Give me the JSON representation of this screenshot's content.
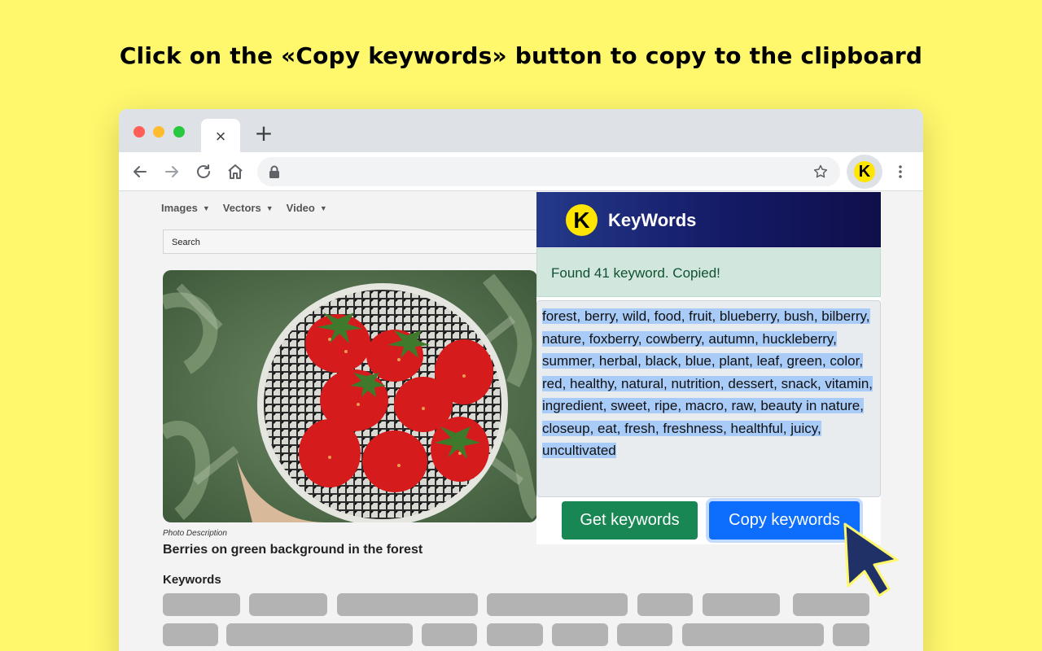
{
  "headline": "Click on the «Copy keywords» button to copy to the clipboard",
  "browser": {
    "tab_close": "×",
    "new_tab": "+",
    "extension_letter": "K",
    "window_dot_colors": [
      "#ff5f57",
      "#febc2e",
      "#28c840"
    ]
  },
  "page": {
    "nav": [
      {
        "label": "Images"
      },
      {
        "label": "Vectors"
      },
      {
        "label": "Video"
      }
    ],
    "search_placeholder": "Search",
    "photo_caption": "Photo Description",
    "photo_title": "Berries on green background in the forest",
    "keywords_label": "Keywords"
  },
  "popup": {
    "logo_letter": "K",
    "title": "KeyWords",
    "status": "Found 41 keyword.  Copied!",
    "keywords_text": "forest, berry, wild, food, fruit, blueberry, bush, bilberry, nature, foxberry, cowberry, autumn, huckleberry, summer, herbal, black, blue, plant, leaf, green, color, red, healthy, natural, nutrition, dessert, snack, vitamin, ingredient, sweet, ripe, macro, raw, beauty in nature, closeup, eat, fresh, freshness, healthful, juicy, uncultivated",
    "get_button": "Get keywords",
    "copy_button": "Copy keywords"
  },
  "colors": {
    "background": "#fff86d",
    "popup_header": "#141a66",
    "success_alert": "#d1e7dd",
    "get_button": "#198754",
    "copy_button": "#0d6efd",
    "selection": "#a8cbf7",
    "cursor": "#1f3166"
  }
}
